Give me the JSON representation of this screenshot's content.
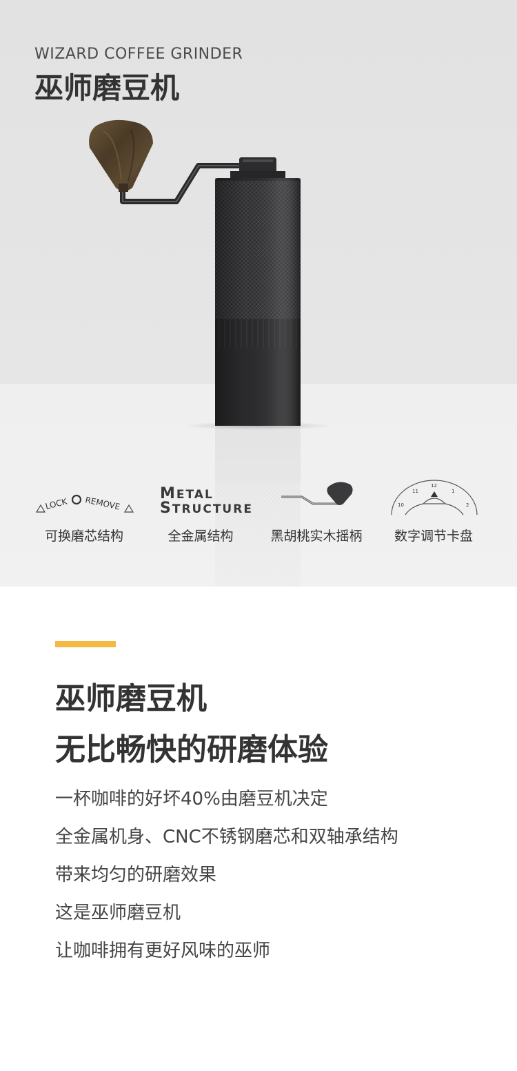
{
  "header": {
    "subtitle_en": "WIZARD COFFEE GRINDER",
    "title_cn": "巫师磨豆机"
  },
  "features": [
    {
      "label": "可换磨芯结构",
      "icon": "lock-remove-icon",
      "icon_text": {
        "lock": "LOCK",
        "remove": "REMOVE"
      }
    },
    {
      "label": "全金属结构",
      "icon": "metal-structure-icon",
      "icon_text": {
        "line1_cap": "M",
        "line1_rest": "ETAL",
        "line2_cap": "S",
        "line2_rest": "TRUCTURE"
      }
    },
    {
      "label": "黑胡桃实木摇柄",
      "icon": "crank-handle-icon"
    },
    {
      "label": "数字调节卡盘",
      "icon": "dial-icon",
      "dial_numbers": [
        "10",
        "11",
        "12",
        "1",
        "2"
      ]
    }
  ],
  "content": {
    "accent_color": "#f4b942",
    "headline_lines": [
      "巫师磨豆机",
      "无比畅快的研磨体验"
    ],
    "body_lines": [
      "一杯咖啡的好坏40%由磨豆机决定",
      "全金属机身、CNC不锈钢磨芯和双轴承结构",
      "带来均匀的研磨效果",
      "这是巫师磨豆机",
      "让咖啡拥有更好风味的巫师"
    ]
  },
  "colors": {
    "hero_background": "#e4e4e4",
    "floor_background": "#f0f0f0",
    "grinder_body": "#2b2b2d",
    "wood_handle": "#5a4630",
    "text_dark": "#333333"
  }
}
